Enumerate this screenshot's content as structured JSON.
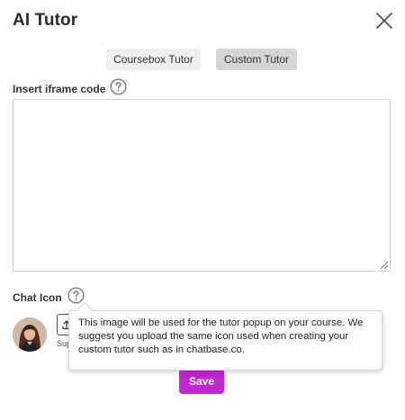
{
  "modal": {
    "title": "AI Tutor"
  },
  "tabs": [
    {
      "label": "Coursebox Tutor",
      "active": false
    },
    {
      "label": "Custom Tutor",
      "active": true
    }
  ],
  "iframe": {
    "label": "Insert iframe code",
    "value": ""
  },
  "chat_icon": {
    "label": "Chat Icon",
    "support_text": "Sup"
  },
  "tooltip": {
    "text": "This image will be used for the tutor popup on your course. We suggest you upload the same icon used when creating your custom tutor such as in chatbase.co."
  },
  "actions": {
    "save_label": "Save"
  },
  "colors": {
    "accent": "#c026d3",
    "active_tab": "#d5d5d5",
    "inactive_tab": "#efefef"
  },
  "icons": {
    "close": "close-icon",
    "help": "question-circle-icon",
    "upload": "upload-icon"
  }
}
